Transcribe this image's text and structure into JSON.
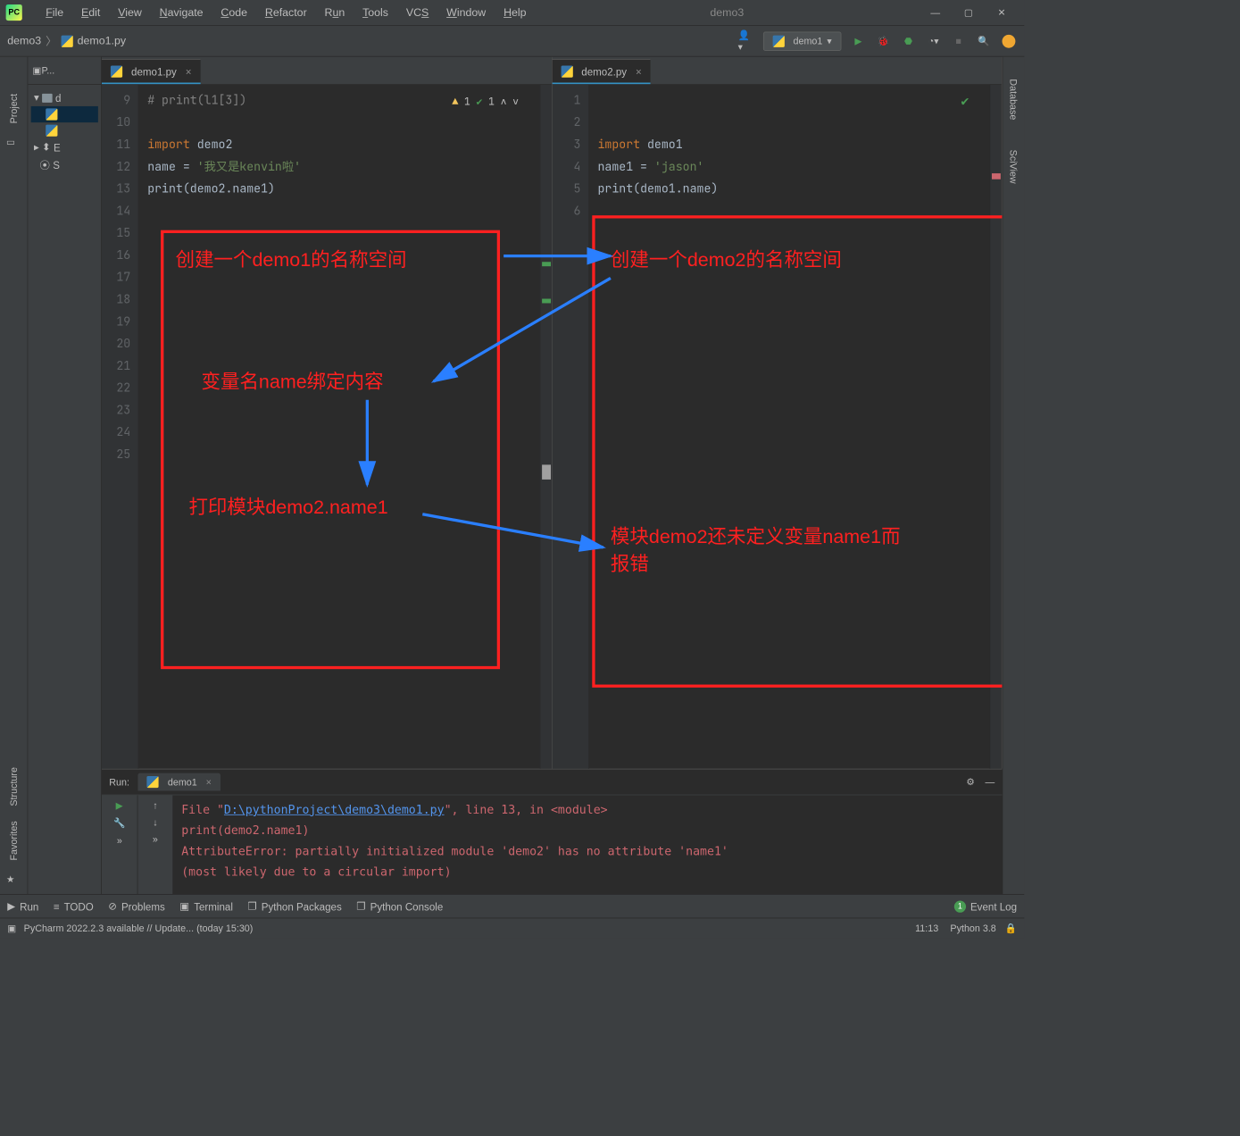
{
  "app_title": "demo3",
  "menus": {
    "file": "File",
    "edit": "Edit",
    "view": "View",
    "navigate": "Navigate",
    "code": "Code",
    "refactor": "Refactor",
    "run": "Run",
    "tools": "Tools",
    "vcs": "VCS",
    "window": "Window",
    "help": "Help"
  },
  "breadcrumb": {
    "root": "demo3",
    "file": "demo1.py"
  },
  "run_config": "demo1",
  "project": {
    "header": "P...",
    "root": "d",
    "ext": "E",
    "scratch": "S"
  },
  "editor1": {
    "tab": "demo1.py",
    "warn_count": "1",
    "ok_count": "1",
    "lines": [
      "9",
      "10",
      "11",
      "12",
      "13",
      "14",
      "15",
      "16",
      "17",
      "18",
      "19",
      "20",
      "21",
      "22",
      "23",
      "24",
      "25"
    ],
    "c0": "# print(l1[3])",
    "c2_import": "import",
    "c2_mod": "demo2",
    "c3_lhs": "name = ",
    "c3_str": "'我又是kenvin啦'",
    "c4_print": "print",
    "c4_open": "(",
    "c4_mod": "demo2",
    "c4_dot": ".name1)"
  },
  "editor2": {
    "tab": "demo2.py",
    "lines": [
      "1",
      "2",
      "3",
      "4",
      "5",
      "6"
    ],
    "c2_import": "import",
    "c2_mod": "demo1",
    "c3_lhs": "name1 = ",
    "c3_str": "'jason'",
    "c4_print": "print",
    "c4_open": "(",
    "c4_mod": "demo1",
    "c4_dot": ".name)"
  },
  "annotations": {
    "a1": "创建一个demo1的名称空间",
    "a2": "创建一个demo2的名称空间",
    "a3": "变量名name绑定内容",
    "a4": "打印模块demo2.name1",
    "a5": "模块demo2还未定义变量name1而报错"
  },
  "run": {
    "tab": "demo1",
    "l1a": "  File \"",
    "l1_path": "D:\\pythonProject\\demo3\\demo1.py",
    "l1b": "\", line 13, in <module>",
    "l2": "    print(demo2.name1)",
    "l3": "AttributeError: partially initialized module 'demo2' has no attribute 'name1'",
    "l4": "  (most likely due to a circular import)"
  },
  "toolwindows": {
    "run": "Run",
    "todo": "TODO",
    "problems": "Problems",
    "terminal": "Terminal",
    "packages": "Python Packages",
    "console": "Python Console",
    "eventlog": "Event Log",
    "badge": "1"
  },
  "sidebars": {
    "project": "Project",
    "structure": "Structure",
    "favorites": "Favorites",
    "database": "Database",
    "sciview": "SciView"
  },
  "status": {
    "update": "PyCharm 2022.2.3 available // Update... (today 15:30)",
    "cursor": "11:13",
    "interp": "Python 3.8"
  }
}
